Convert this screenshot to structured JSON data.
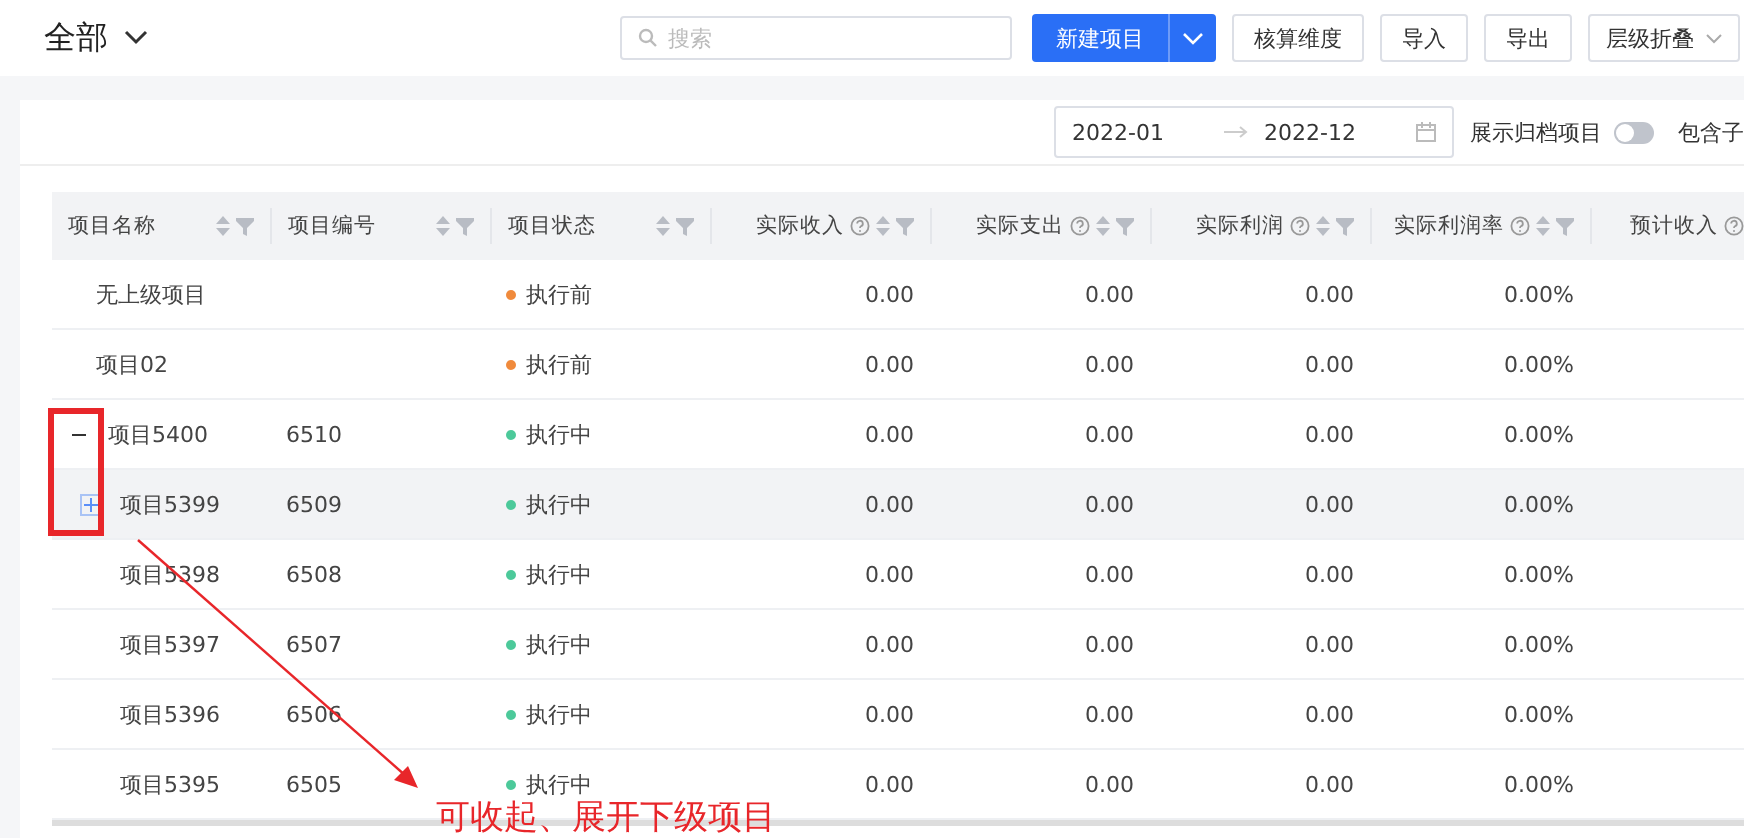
{
  "header": {
    "title": "全部"
  },
  "search": {
    "placeholder": "搜索"
  },
  "toolbar": {
    "primary_button": "新建项目",
    "buttons": [
      "核算维度",
      "导入",
      "导出"
    ],
    "dropdown": "层级折叠"
  },
  "filters": {
    "date_start": "2022-01",
    "date_end": "2022-12",
    "archive_toggle": {
      "label": "展示归档项目",
      "on": false
    },
    "include_label": "包含子"
  },
  "table": {
    "columns": [
      {
        "label": "项目名称",
        "kind": "text",
        "help": false,
        "sortable": true
      },
      {
        "label": "项目编号",
        "kind": "text",
        "help": false,
        "sortable": true
      },
      {
        "label": "项目状态",
        "kind": "text",
        "help": false,
        "sortable": true
      },
      {
        "label": "实际收入",
        "kind": "amount",
        "help": true,
        "sortable": true
      },
      {
        "label": "实际支出",
        "kind": "amount",
        "help": true,
        "sortable": true
      },
      {
        "label": "实际利润",
        "kind": "amount",
        "help": true,
        "sortable": true
      },
      {
        "label": "实际利润率",
        "kind": "amount",
        "help": true,
        "sortable": true
      },
      {
        "label": "预计收入",
        "kind": "amount",
        "help": true,
        "sortable": false
      }
    ],
    "rows": [
      {
        "name": "无上级项目",
        "code": "",
        "status": "执行前",
        "color": "#f08a3c",
        "values": [
          "0.00",
          "0.00",
          "0.00",
          "0.00%"
        ],
        "highlighted": false
      },
      {
        "name": "项目02",
        "code": "",
        "status": "执行前",
        "color": "#f08a3c",
        "values": [
          "0.00",
          "0.00",
          "0.00",
          "0.00%"
        ],
        "highlighted": false
      },
      {
        "name": "项目5400",
        "code": "6510",
        "status": "执行中",
        "color": "#4cc99a",
        "values": [
          "0.00",
          "0.00",
          "0.00",
          "0.00%"
        ],
        "highlighted": false,
        "expanded": true,
        "children": [
          {
            "name": "项目5399",
            "code": "6509",
            "status": "执行中",
            "color": "#4cc99a",
            "values": [
              "0.00",
              "0.00",
              "0.00",
              "0.00%"
            ],
            "highlighted": true,
            "expanded": false
          },
          {
            "name": "项目5398",
            "code": "6508",
            "status": "执行中",
            "color": "#4cc99a",
            "values": [
              "0.00",
              "0.00",
              "0.00",
              "0.00%"
            ],
            "highlighted": false
          },
          {
            "name": "项目5397",
            "code": "6507",
            "status": "执行中",
            "color": "#4cc99a",
            "values": [
              "0.00",
              "0.00",
              "0.00",
              "0.00%"
            ],
            "highlighted": false
          },
          {
            "name": "项目5396",
            "code": "6506",
            "status": "执行中",
            "color": "#4cc99a",
            "values": [
              "0.00",
              "0.00",
              "0.00",
              "0.00%"
            ],
            "highlighted": false
          },
          {
            "name": "项目5395",
            "code": "6505",
            "status": "执行中",
            "color": "#4cc99a",
            "values": [
              "0.00",
              "0.00",
              "0.00",
              "0.00%"
            ],
            "highlighted": false
          }
        ]
      }
    ]
  },
  "annotation": {
    "text": "可收起、展开下级项目"
  }
}
